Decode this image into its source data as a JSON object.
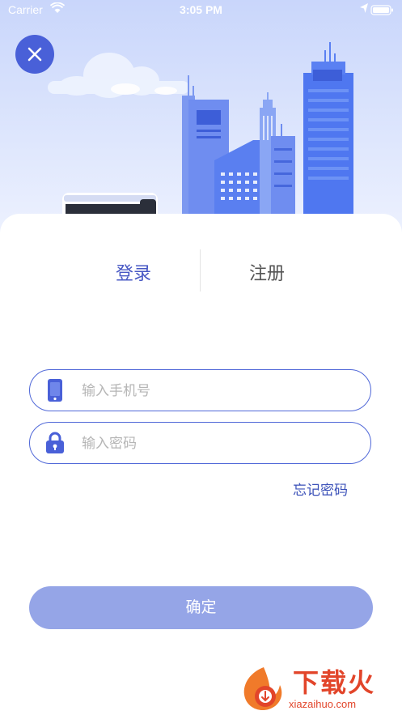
{
  "status_bar": {
    "carrier": "Carrier",
    "time": "3:05 PM"
  },
  "icons": {
    "close": "close-icon",
    "phone": "phone-icon",
    "lock": "lock-icon",
    "wifi": "wifi-icon",
    "location": "location-arrow-icon",
    "battery": "battery-icon"
  },
  "tabs": [
    {
      "label": "登录",
      "active": true
    },
    {
      "label": "注册",
      "active": false
    }
  ],
  "form": {
    "phone_placeholder": "输入手机号",
    "phone_value": "",
    "password_placeholder": "输入密码",
    "password_value": "",
    "forgot_label": "忘记密码",
    "confirm_label": "确定"
  },
  "watermark": {
    "brand": "下载火",
    "url": "xiazaihuo.com"
  },
  "colors": {
    "accent": "#4858c4",
    "close_button": "#4960d8",
    "field_border": "#5068d8",
    "confirm_button": "#95a5e7",
    "watermark": "#e2452a"
  }
}
